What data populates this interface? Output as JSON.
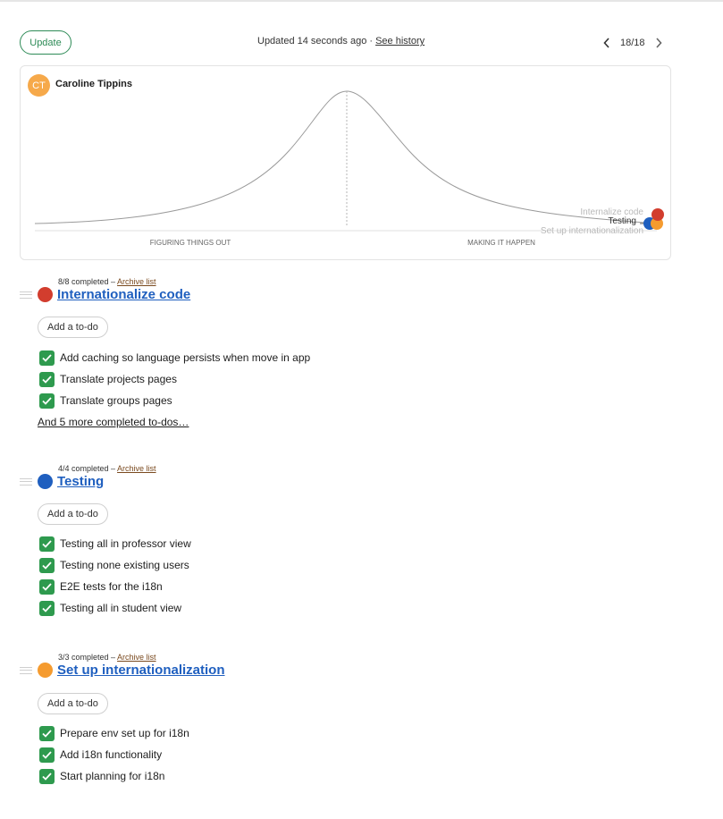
{
  "toolbar": {
    "update_label": "Update",
    "updated_text": "Updated 14 seconds ago · ",
    "history_label": "See history",
    "page_count": "18/18"
  },
  "hill": {
    "avatar_initials": "CT",
    "owner_name": "Caroline Tippins",
    "left_phase": "FIGURING THINGS OUT",
    "right_phase": "MAKING IT HAPPEN",
    "dots": [
      {
        "label": "Internalize code",
        "color": "#d23d2e"
      },
      {
        "label": "Testing",
        "color": "#1f5fbf"
      },
      {
        "label": "Set up internationalization",
        "color": "#f59b2f"
      }
    ]
  },
  "lists": [
    {
      "meta": "8/8 completed – ",
      "archive_label": "Archive list",
      "color": "#d23d2e",
      "title": "Internationalize code",
      "add_label": "Add a to-do",
      "todos": [
        "Add caching so language persists when move in app",
        "Translate projects pages",
        "Translate groups pages"
      ],
      "more_label": "And 5 more completed to-dos…"
    },
    {
      "meta": "4/4 completed – ",
      "archive_label": "Archive list",
      "color": "#1f5fbf",
      "title": "Testing",
      "add_label": "Add a to-do",
      "todos": [
        "Testing all in professor view",
        "Testing none existing users",
        "E2E tests for the i18n",
        "Testing all in student view"
      ]
    },
    {
      "meta": "3/3 completed – ",
      "archive_label": "Archive list",
      "color": "#f59b2f",
      "title": "Set up internationalization",
      "add_label": "Add a to-do",
      "todos": [
        "Prepare env set up for i18n",
        "Add i18n functionality",
        "Start planning for i18n"
      ]
    }
  ]
}
